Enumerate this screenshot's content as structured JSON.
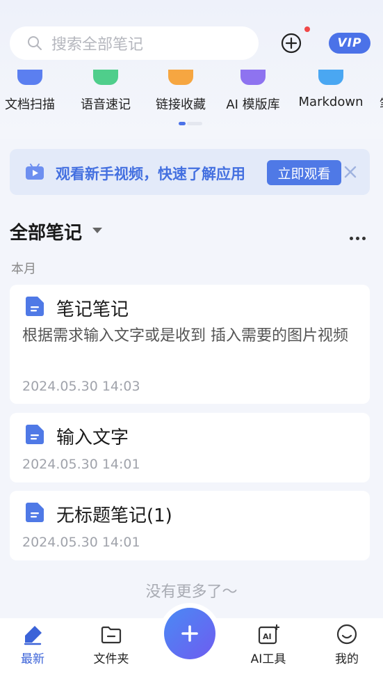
{
  "search": {
    "placeholder": "搜索全部笔记"
  },
  "header": {
    "vip_label": "VIP"
  },
  "tools": [
    {
      "label": "文档扫描",
      "color": "#5b7ff0"
    },
    {
      "label": "语音速记",
      "color": "#4fce8b"
    },
    {
      "label": "链接收藏",
      "color": "#f6a641"
    },
    {
      "label": "AI 模版库",
      "color": "#8e73f0"
    },
    {
      "label": "Markdown",
      "color": "#4aa7f2"
    },
    {
      "label": "笔",
      "color": "#999999"
    }
  ],
  "banner": {
    "text": "观看新手视频，快速了解应用",
    "button": "立即观看"
  },
  "section": {
    "title": "全部笔记",
    "month": "本月"
  },
  "notes": [
    {
      "title": "笔记笔记",
      "body": "根据需求输入文字或是收到 插入需要的图片视频",
      "date": "2024.05.30 14:03"
    },
    {
      "title": "输入文字",
      "date": "2024.05.30 14:01"
    },
    {
      "title": "无标题笔记(1)",
      "date": "2024.05.30 14:01"
    }
  ],
  "footer_text": "没有更多了～",
  "tabs": [
    {
      "label": "最新",
      "active": true
    },
    {
      "label": "文件夹"
    },
    {
      "label": "AI工具"
    },
    {
      "label": "我的"
    }
  ],
  "colors": {
    "accent": "#4b72e8",
    "active_tab": "#3b63d8"
  }
}
